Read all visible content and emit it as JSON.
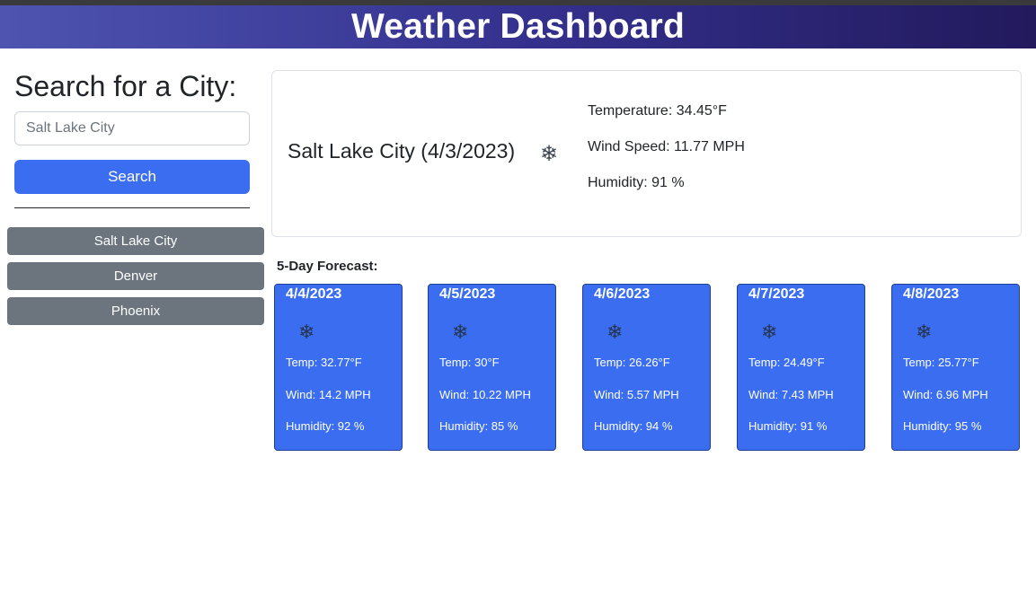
{
  "header": {
    "title": "Weather Dashboard"
  },
  "search": {
    "title": "Search for a City:",
    "placeholder": "Salt Lake City",
    "button_label": "Search",
    "history": [
      "Salt Lake City",
      "Denver",
      "Phoenix"
    ]
  },
  "current": {
    "city_date": "Salt Lake City (4/3/2023)",
    "icon": "snowflake-icon",
    "temperature": "Temperature: 34.45°F",
    "wind": "Wind Speed: 11.77 MPH",
    "humidity": "Humidity: 91 %"
  },
  "forecast": {
    "title": "5-Day Forecast:",
    "days": [
      {
        "date": "4/4/2023",
        "icon": "snowflake-icon",
        "temp": "Temp: 32.77°F",
        "wind": "Wind: 14.2 MPH",
        "humidity": "Humidity: 92 %"
      },
      {
        "date": "4/5/2023",
        "icon": "snowflake-icon",
        "temp": "Temp: 30°F",
        "wind": "Wind: 10.22 MPH",
        "humidity": "Humidity: 85 %"
      },
      {
        "date": "4/6/2023",
        "icon": "snowflake-icon",
        "temp": "Temp: 26.26°F",
        "wind": "Wind: 5.57 MPH",
        "humidity": "Humidity: 94 %"
      },
      {
        "date": "4/7/2023",
        "icon": "snowflake-icon",
        "temp": "Temp: 24.49°F",
        "wind": "Wind: 7.43 MPH",
        "humidity": "Humidity: 91 %"
      },
      {
        "date": "4/8/2023",
        "icon": "snowflake-icon",
        "temp": "Temp: 25.77°F",
        "wind": "Wind: 6.96 MPH",
        "humidity": "Humidity: 95 %"
      }
    ]
  },
  "colors": {
    "primary": "#3a6df0",
    "secondary": "#6c757d",
    "header_start": "#4e54b0",
    "header_end": "#221a5c"
  }
}
